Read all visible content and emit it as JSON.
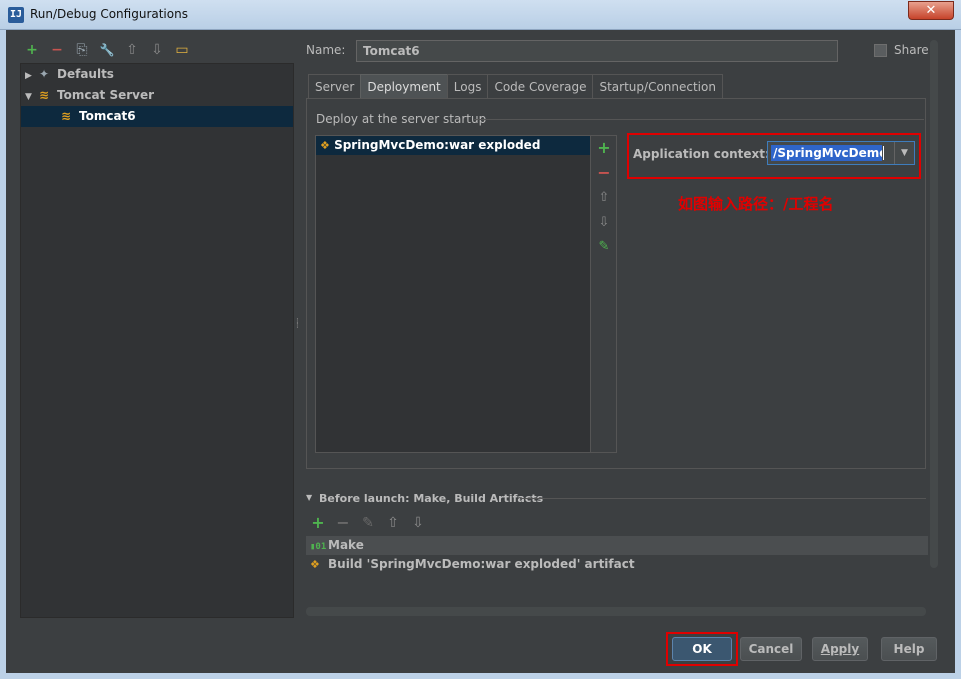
{
  "window": {
    "title": "Run/Debug Configurations",
    "app_icon": "IJ",
    "close_glyph": "✕"
  },
  "toolbar": {
    "add": "+",
    "remove": "−",
    "copy": "⎘",
    "edit_defaults": "🔧",
    "move_up": "⇧",
    "move_down": "⇩",
    "folder": "▭"
  },
  "tree": {
    "items": [
      {
        "label": "Defaults",
        "icon": "wrench-icon"
      },
      {
        "label": "Tomcat Server",
        "icon": "tomcat-icon"
      },
      {
        "label": "Tomcat6",
        "icon": "tomcat-icon"
      }
    ]
  },
  "config": {
    "name_label": "Name:",
    "name_value": "Tomcat6",
    "share_label": "Share"
  },
  "tabs": [
    {
      "label": "Server"
    },
    {
      "label": "Deployment"
    },
    {
      "label": "Logs"
    },
    {
      "label": "Code Coverage"
    },
    {
      "label": "Startup/Connection"
    }
  ],
  "deployment": {
    "section_label": "Deploy at the server startup",
    "artifact": "SpringMvcDemo:war exploded",
    "app_context_label": "Application context:",
    "app_context_value": "/SpringMvcDemo",
    "annotation": "如图输入路径：/工程名"
  },
  "before_launch": {
    "label": "Before launch: Make, Build Artifacts",
    "tasks": [
      {
        "label": "Make"
      },
      {
        "label": "Build 'SpringMvcDemo:war exploded' artifact"
      }
    ]
  },
  "buttons": {
    "ok": "OK",
    "cancel": "Cancel",
    "apply": "Apply",
    "help": "Help"
  },
  "colors": {
    "background": "#3c3f41",
    "selection": "#0d293e",
    "highlight_box": "#e00000",
    "add_green": "#4fb34f",
    "remove_red": "#c75450"
  }
}
